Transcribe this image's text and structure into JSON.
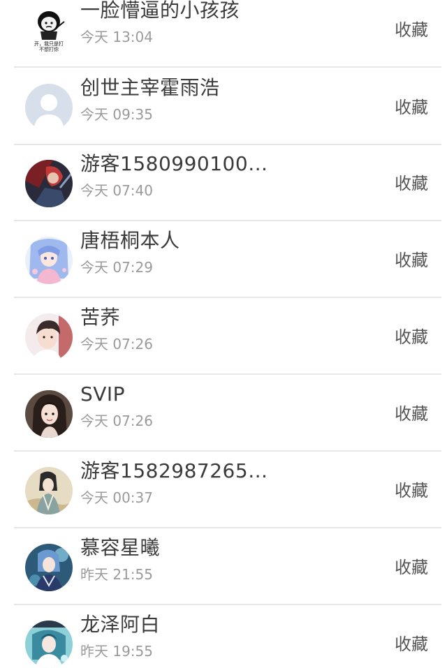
{
  "action_label": "收藏",
  "items": [
    {
      "name": "一脸懵逼的小孩孩",
      "time": "今天 13:04",
      "avatar": "meme-avatar-icon",
      "avatar_text": [
        "开，我只是打",
        "不想打你"
      ]
    },
    {
      "name": "创世主宰霍雨浩",
      "time": "今天 09:35",
      "avatar": "default-user-avatar-icon"
    },
    {
      "name": "游客1580990100…",
      "time": "今天 07:40",
      "avatar": "dark-red-character-avatar"
    },
    {
      "name": "唐梧桐本人",
      "time": "今天 07:29",
      "avatar": "anime-girl-avatar"
    },
    {
      "name": "苦荞",
      "time": "今天 07:26",
      "avatar": "boy-photo-avatar"
    },
    {
      "name": "SVIP",
      "time": "今天 07:26",
      "avatar": "girl-photo-avatar"
    },
    {
      "name": "游客1582987265…",
      "time": "今天 00:37",
      "avatar": "ancient-style-avatar"
    },
    {
      "name": "慕容星曦",
      "time": "昨天 21:55",
      "avatar": "blue-anime-avatar"
    },
    {
      "name": "龙泽阿白",
      "time": "昨天 19:55",
      "avatar": "cyan-anime-avatar"
    }
  ]
}
